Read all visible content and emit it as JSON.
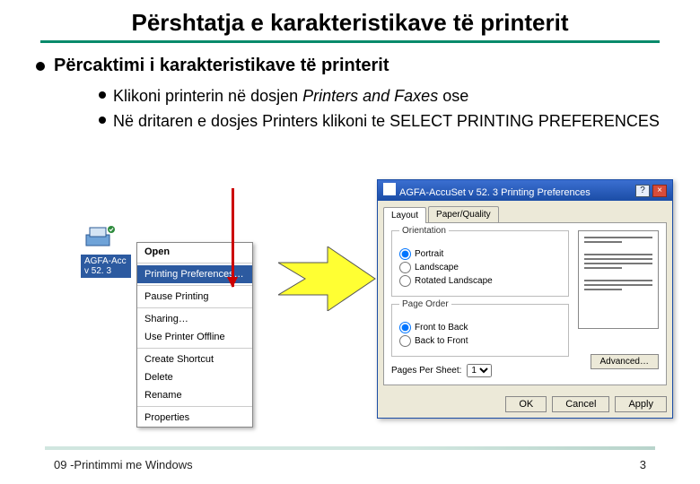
{
  "title": "Përshtatja e karakteristikave të printerit",
  "l1": "Përcaktimi i karakteristikave të printerit",
  "l2a_pre": "Klikoni printerin në dosjen ",
  "l2a_ital": "Printers and Faxes",
  "l2a_post": " ose",
  "l2b": "Në dritaren e dosjes Printers klikoni te SELECT PRINTING PREFERENCES",
  "printer_label": "AGFA-Acc v 52. 3",
  "ctx": {
    "open": "Open",
    "pref": "Printing Preferences…",
    "pause": "Pause Printing",
    "share": "Sharing…",
    "offline": "Use Printer Offline",
    "shortcut": "Create Shortcut",
    "delete": "Delete",
    "rename": "Rename",
    "props": "Properties"
  },
  "dialog": {
    "title": "AGFA-AccuSet v 52. 3 Printing Preferences",
    "tab_layout": "Layout",
    "tab_pq": "Paper/Quality",
    "grp_orient": "Orientation",
    "orient_portrait": "Portrait",
    "orient_landscape": "Landscape",
    "orient_rot": "Rotated Landscape",
    "grp_order": "Page Order",
    "order_ftb": "Front to Back",
    "order_btf": "Back to Front",
    "pps_label": "Pages Per Sheet:",
    "pps_value": "1",
    "advanced": "Advanced…",
    "ok": "OK",
    "cancel": "Cancel",
    "apply": "Apply"
  },
  "footer_left": "09 -Printimmi me Windows",
  "footer_right": "3"
}
